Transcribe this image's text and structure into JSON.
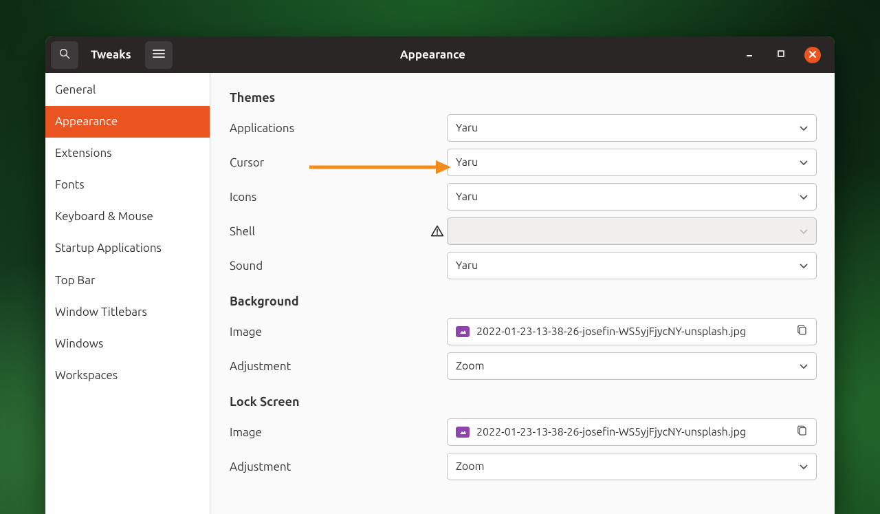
{
  "titlebar": {
    "app_title": "Tweaks",
    "page_title": "Appearance"
  },
  "sidebar": {
    "items": [
      {
        "label": "General",
        "active": false
      },
      {
        "label": "Appearance",
        "active": true
      },
      {
        "label": "Extensions",
        "active": false
      },
      {
        "label": "Fonts",
        "active": false
      },
      {
        "label": "Keyboard & Mouse",
        "active": false
      },
      {
        "label": "Startup Applications",
        "active": false
      },
      {
        "label": "Top Bar",
        "active": false
      },
      {
        "label": "Window Titlebars",
        "active": false
      },
      {
        "label": "Windows",
        "active": false
      },
      {
        "label": "Workspaces",
        "active": false
      }
    ]
  },
  "themes": {
    "heading": "Themes",
    "applications": {
      "label": "Applications",
      "value": "Yaru"
    },
    "cursor": {
      "label": "Cursor",
      "value": "Yaru"
    },
    "icons": {
      "label": "Icons",
      "value": "Yaru"
    },
    "shell": {
      "label": "Shell",
      "value": ""
    },
    "sound": {
      "label": "Sound",
      "value": "Yaru"
    }
  },
  "background": {
    "heading": "Background",
    "image": {
      "label": "Image",
      "filename": "2022-01-23-13-38-26-josefin-WS5yjFjycNY-unsplash.jpg"
    },
    "adjustment": {
      "label": "Adjustment",
      "value": "Zoom"
    }
  },
  "lock_screen": {
    "heading": "Lock Screen",
    "image": {
      "label": "Image",
      "filename": "2022-01-23-13-38-26-josefin-WS5yjFjycNY-unsplash.jpg"
    },
    "adjustment": {
      "label": "Adjustment",
      "value": "Zoom"
    }
  }
}
